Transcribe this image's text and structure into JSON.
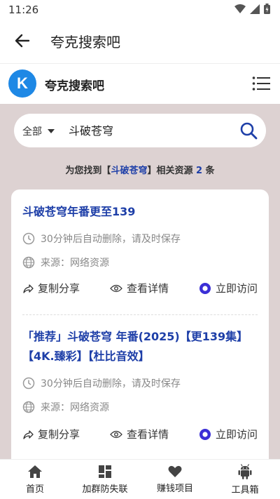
{
  "status": {
    "time": "11:26"
  },
  "app_bar": {
    "title": "夸克搜索吧"
  },
  "site": {
    "logo_letter": "K",
    "name": "夸克搜索吧"
  },
  "search": {
    "scope": "全部",
    "query": "斗破苍穹"
  },
  "result_summary": {
    "prefix": "为您找到【",
    "keyword": "斗破苍穹",
    "middle": "】相关资源 ",
    "count": "2",
    "suffix": " 条"
  },
  "results": [
    {
      "title": "斗破苍穹年番更至139",
      "notice": "30分钟后自动删除，请及时保存",
      "source": "来源：网络资源",
      "copy_label": "复制分享",
      "detail_label": "查看详情",
      "visit_label": "立即访问"
    },
    {
      "title": "「推荐」斗破苍穹 年番(2025)【更139集】【4K.臻彩】【杜比音效】",
      "notice": "30分钟后自动删除，请及时保存",
      "source": "来源：网络资源",
      "copy_label": "复制分享",
      "detail_label": "查看详情",
      "visit_label": "立即访问"
    }
  ],
  "bottom_nav": [
    {
      "label": "首页",
      "icon": "home-icon"
    },
    {
      "label": "加群防失联",
      "icon": "grid-icon"
    },
    {
      "label": "赚钱项目",
      "icon": "heart-icon"
    },
    {
      "label": "工具箱",
      "icon": "android-icon"
    }
  ],
  "colors": {
    "accent": "#1e3fa8",
    "visit": "#3b2fd6",
    "background": "#ddd2d2",
    "logo": "#1e88e5"
  }
}
